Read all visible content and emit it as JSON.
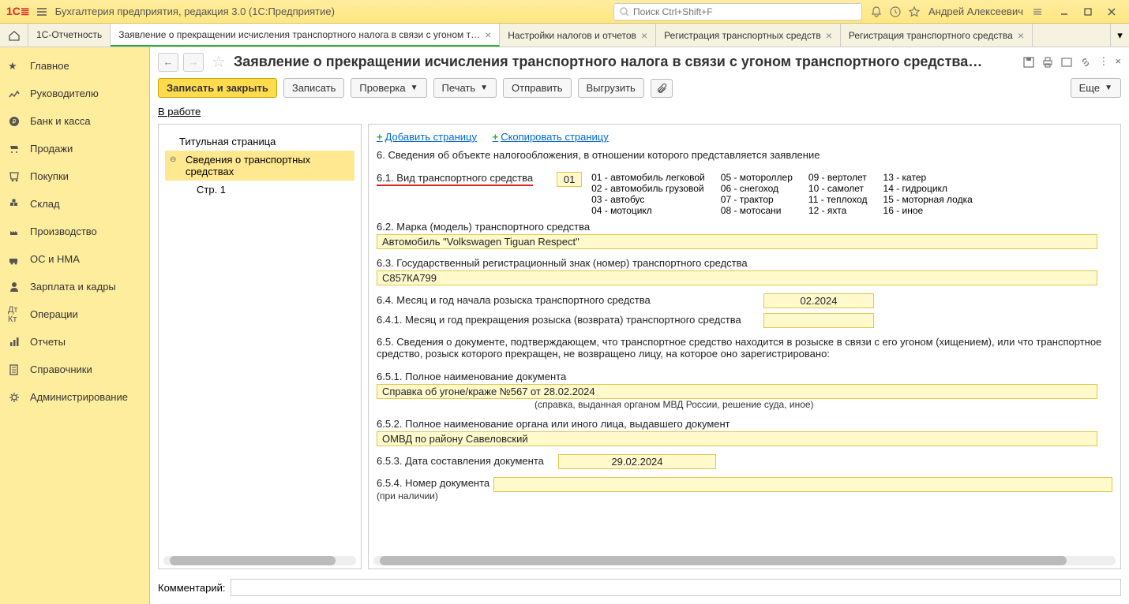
{
  "titlebar": {
    "app_title": "Бухгалтерия предприятия, редакция 3.0  (1С:Предприятие)",
    "search_placeholder": "Поиск Ctrl+Shift+F",
    "user": "Андрей Алексеевич"
  },
  "tabs": [
    {
      "label": "1С-Отчетность"
    },
    {
      "label": "Заявление о прекращении исчисления транспортного налога в связи с угоном т…",
      "active": true
    },
    {
      "label": "Настройки налогов и отчетов"
    },
    {
      "label": "Регистрация транспортных средств"
    },
    {
      "label": "Регистрация транспортного средства"
    }
  ],
  "sidebar": [
    {
      "label": "Главное"
    },
    {
      "label": "Руководителю"
    },
    {
      "label": "Банк и касса"
    },
    {
      "label": "Продажи"
    },
    {
      "label": "Покупки"
    },
    {
      "label": "Склад"
    },
    {
      "label": "Производство"
    },
    {
      "label": "ОС и НМА"
    },
    {
      "label": "Зарплата и кадры"
    },
    {
      "label": "Операции"
    },
    {
      "label": "Отчеты"
    },
    {
      "label": "Справочники"
    },
    {
      "label": "Администрирование"
    }
  ],
  "doc_title": "Заявление о прекращении исчисления транспортного налога в связи с угоном транспортного средства…",
  "toolbar": {
    "save_close": "Записать и закрыть",
    "save": "Записать",
    "check": "Проверка",
    "print": "Печать",
    "send": "Отправить",
    "export": "Выгрузить",
    "more": "Еще"
  },
  "status": "В работе",
  "tree": {
    "title": "Титульная страница",
    "vehicles": "Сведения о транспортных средствах",
    "page1": "Стр. 1"
  },
  "form": {
    "add_page": "Добавить страницу",
    "copy_page": "Скопировать страницу",
    "sec6": "6. Сведения об объекте налогообложения, в отношении которого представляется заявление",
    "sec61": "6.1. Вид транспортного средства",
    "code": "01",
    "legend": [
      "01 - автомобиль легковой",
      "05 - мотороллер",
      "09 - вертолет",
      "13 - катер",
      "02 - автомобиль грузовой",
      "06 - снегоход",
      "10 - самолет",
      "14 - гидроцикл",
      "03 - автобус",
      "07 - трактор",
      "11 - теплоход",
      "15 - моторная лодка",
      "04 - мотоцикл",
      "08 - мотосани",
      "12 - яхта",
      "16 - иное"
    ],
    "sec62": "6.2. Марка (модель) транспортного средства",
    "val62": "Автомобиль \"Volkswagen Tiguan Respect\"",
    "sec63": "6.3. Государственный регистрационный знак (номер) транспортного средства",
    "val63": "С857КА799",
    "sec64": "6.4. Месяц и год начала розыска транспортного средства",
    "val64": "02.2024",
    "sec641": "6.4.1. Месяц и год прекращения розыска (возврата) транспортного средства",
    "val641": "",
    "sec65": "6.5. Сведения о документе, подтверждающем, что транспортное средство находится в розыске в связи с его угоном (хищением), или что транспортное средство, розыск которого прекращен, не возвращено лицу, на которое оно зарегистрировано:",
    "sec651": "6.5.1. Полное наименование документа",
    "val651": "Справка об угоне/краже №567 от 28.02.2024",
    "hint651": "(справка, выданная органом МВД России, решение суда, иное)",
    "sec652": "6.5.2. Полное наименование органа или иного лица, выдавшего документ",
    "val652": "ОМВД по району Савеловский",
    "sec653": "6.5.3. Дата составления документа",
    "val653": "29.02.2024",
    "sec654": "6.5.4. Номер документа",
    "sec654_sub": "(при наличии)",
    "val654": ""
  },
  "comment_label": "Комментарий:"
}
